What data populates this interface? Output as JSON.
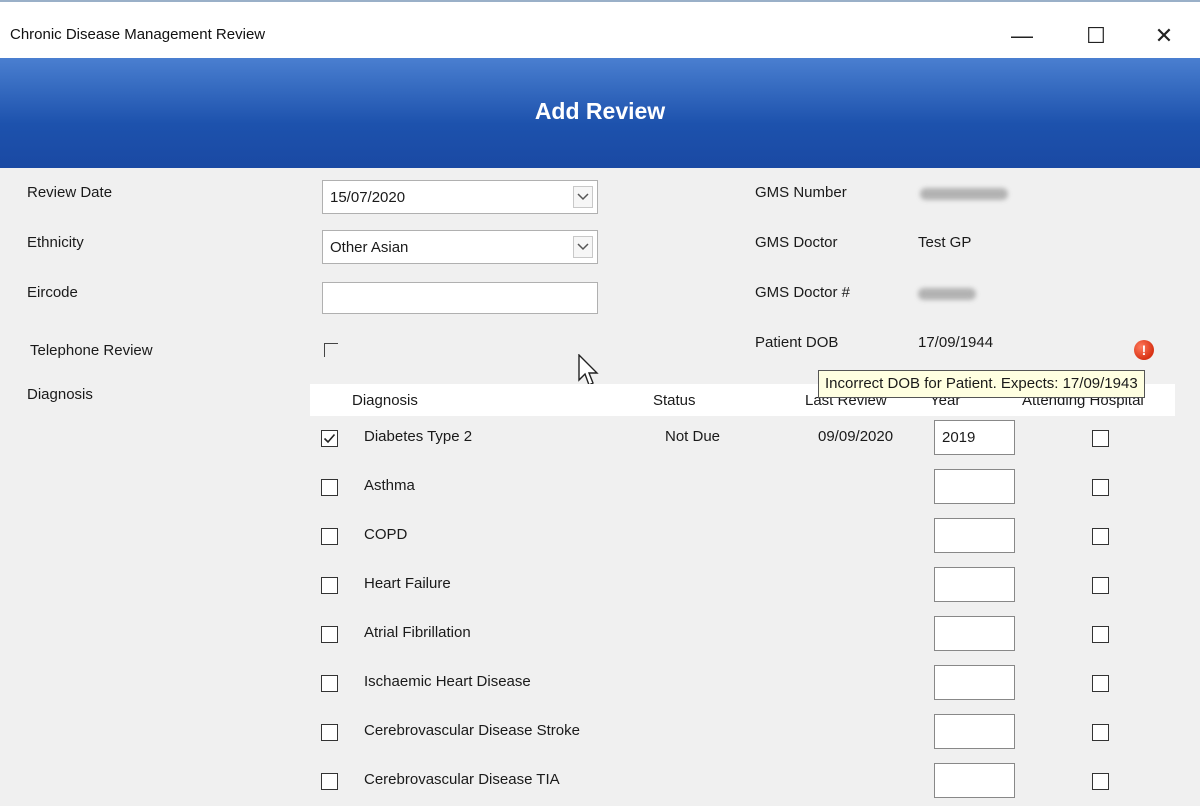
{
  "window": {
    "title": "Chronic Disease Management Review",
    "minimize": "—",
    "maximize": "☐",
    "close": "✕"
  },
  "header": {
    "title": "Add Review"
  },
  "form": {
    "review_date_label": "Review Date",
    "review_date_value": "15/07/2020",
    "ethnicity_label": "Ethnicity",
    "ethnicity_value": "Other Asian",
    "eircode_label": "Eircode",
    "eircode_value": "",
    "telephone_review_label": "Telephone Review",
    "telephone_review_checked": false,
    "diagnosis_label": "Diagnosis"
  },
  "patient": {
    "gms_number_label": "GMS Number",
    "gms_doctor_label": "GMS Doctor",
    "gms_doctor_value": "Test GP",
    "gms_doctor_num_label": "GMS Doctor #",
    "patient_dob_label": "Patient DOB",
    "patient_dob_value": "17/09/1944"
  },
  "grid": {
    "columns": [
      "Diagnosis",
      "Status",
      "Last Review",
      "Year",
      "Attending Hospital"
    ],
    "rows": [
      {
        "checked": true,
        "name": "Diabetes Type 2",
        "status": "Not Due",
        "last_review": "09/09/2020",
        "year": "2019"
      },
      {
        "checked": false,
        "name": "Asthma",
        "status": "",
        "last_review": "",
        "year": ""
      },
      {
        "checked": false,
        "name": "COPD",
        "status": "",
        "last_review": "",
        "year": ""
      },
      {
        "checked": false,
        "name": "Heart Failure",
        "status": "",
        "last_review": "",
        "year": ""
      },
      {
        "checked": false,
        "name": "Atrial Fibrillation",
        "status": "",
        "last_review": "",
        "year": ""
      },
      {
        "checked": false,
        "name": "Ischaemic Heart Disease",
        "status": "",
        "last_review": "",
        "year": ""
      },
      {
        "checked": false,
        "name": "Cerebrovascular Disease Stroke",
        "status": "",
        "last_review": "",
        "year": ""
      },
      {
        "checked": false,
        "name": "Cerebrovascular Disease TIA",
        "status": "",
        "last_review": "",
        "year": ""
      }
    ]
  },
  "tooltip": {
    "text": "Incorrect DOB for Patient. Expects: 17/09/1943"
  },
  "error_icon": {
    "glyph": "!"
  },
  "colors": {
    "header_top": "#4a7fd0",
    "header_bottom": "#1a49a3",
    "tooltip_bg": "#ffffe1",
    "error": "#d83214"
  }
}
